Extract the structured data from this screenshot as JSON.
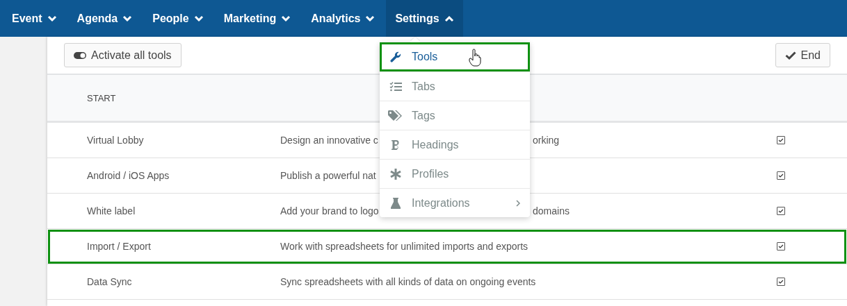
{
  "nav": [
    {
      "label": "Event",
      "expanded": false
    },
    {
      "label": "Agenda",
      "expanded": false
    },
    {
      "label": "People",
      "expanded": false
    },
    {
      "label": "Marketing",
      "expanded": false
    },
    {
      "label": "Analytics",
      "expanded": false
    },
    {
      "label": "Settings",
      "expanded": true
    }
  ],
  "toolbar": {
    "activate_button": "Activate all tools",
    "end_button": "End"
  },
  "menu": [
    {
      "label": "Tools",
      "kind": "wrench",
      "selected": true,
      "highlighted": true,
      "submenu": false
    },
    {
      "label": "Tabs",
      "kind": "checklist",
      "selected": false,
      "highlighted": false,
      "submenu": false
    },
    {
      "label": "Tags",
      "kind": "tag",
      "selected": false,
      "highlighted": false,
      "submenu": false
    },
    {
      "label": "Headings",
      "kind": "bold",
      "selected": false,
      "highlighted": false,
      "submenu": false
    },
    {
      "label": "Profiles",
      "kind": "asterisk",
      "selected": false,
      "highlighted": false,
      "submenu": false
    },
    {
      "label": "Integrations",
      "kind": "flask",
      "selected": false,
      "highlighted": false,
      "submenu": true
    }
  ],
  "table": {
    "columns": [
      "START"
    ],
    "rows": [
      {
        "name": "Virtual Lobby",
        "description": [
          "Design an innovative c",
          "orking"
        ],
        "checked": true,
        "highlighted": false
      },
      {
        "name": "Android / iOS Apps",
        "description": [
          "Publish a powerful nat"
        ],
        "checked": true,
        "highlighted": false
      },
      {
        "name": "White label",
        "description": [
          "Add your brand to logo",
          "domains"
        ],
        "checked": true,
        "highlighted": false
      },
      {
        "name": "Import / Export",
        "description": [
          "Work with spreadsheets for unlimited imports and exports"
        ],
        "checked": true,
        "highlighted": true
      },
      {
        "name": "Data Sync",
        "description": [
          "Sync spreadsheets with all kinds of data on ongoing events"
        ],
        "checked": true,
        "highlighted": false
      }
    ]
  }
}
